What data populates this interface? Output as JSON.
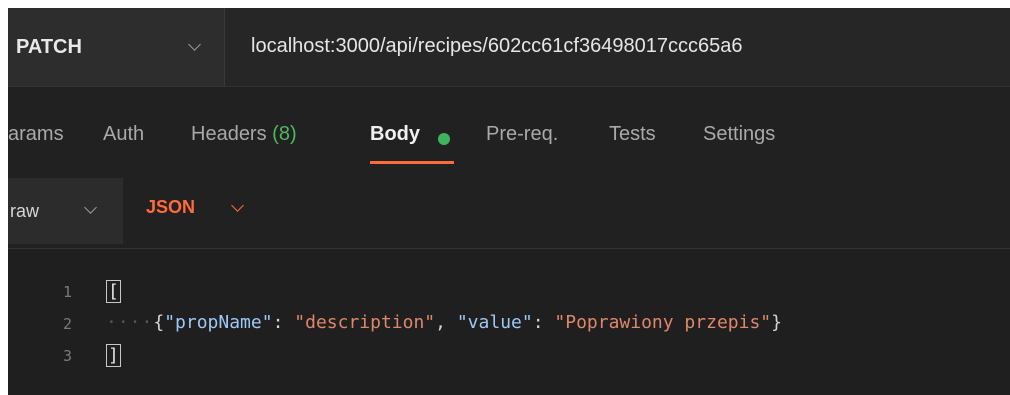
{
  "request": {
    "method": "PATCH",
    "url": "localhost:3000/api/recipes/602cc61cf36498017ccc65a6"
  },
  "tabs": [
    {
      "label": "arams"
    },
    {
      "label": "Auth"
    },
    {
      "label": "Headers",
      "count": "(8)"
    },
    {
      "label": "Body"
    },
    {
      "label": "Pre-req."
    },
    {
      "label": "Tests"
    },
    {
      "label": "Settings"
    }
  ],
  "body_options": {
    "mode": "raw",
    "language": "JSON"
  },
  "editor": {
    "line_numbers": [
      "1",
      "2",
      "3"
    ],
    "open_bracket": "[",
    "indent_dots": "····",
    "key1": "\"propName\"",
    "val1": "\"description\"",
    "key2": "\"value\"",
    "val2": "\"Poprawiony przepis\"",
    "close_bracket": "]"
  },
  "colors": {
    "accent": "#ff6c37",
    "active_dot": "#3fb35f",
    "count": "#4fb85c"
  }
}
